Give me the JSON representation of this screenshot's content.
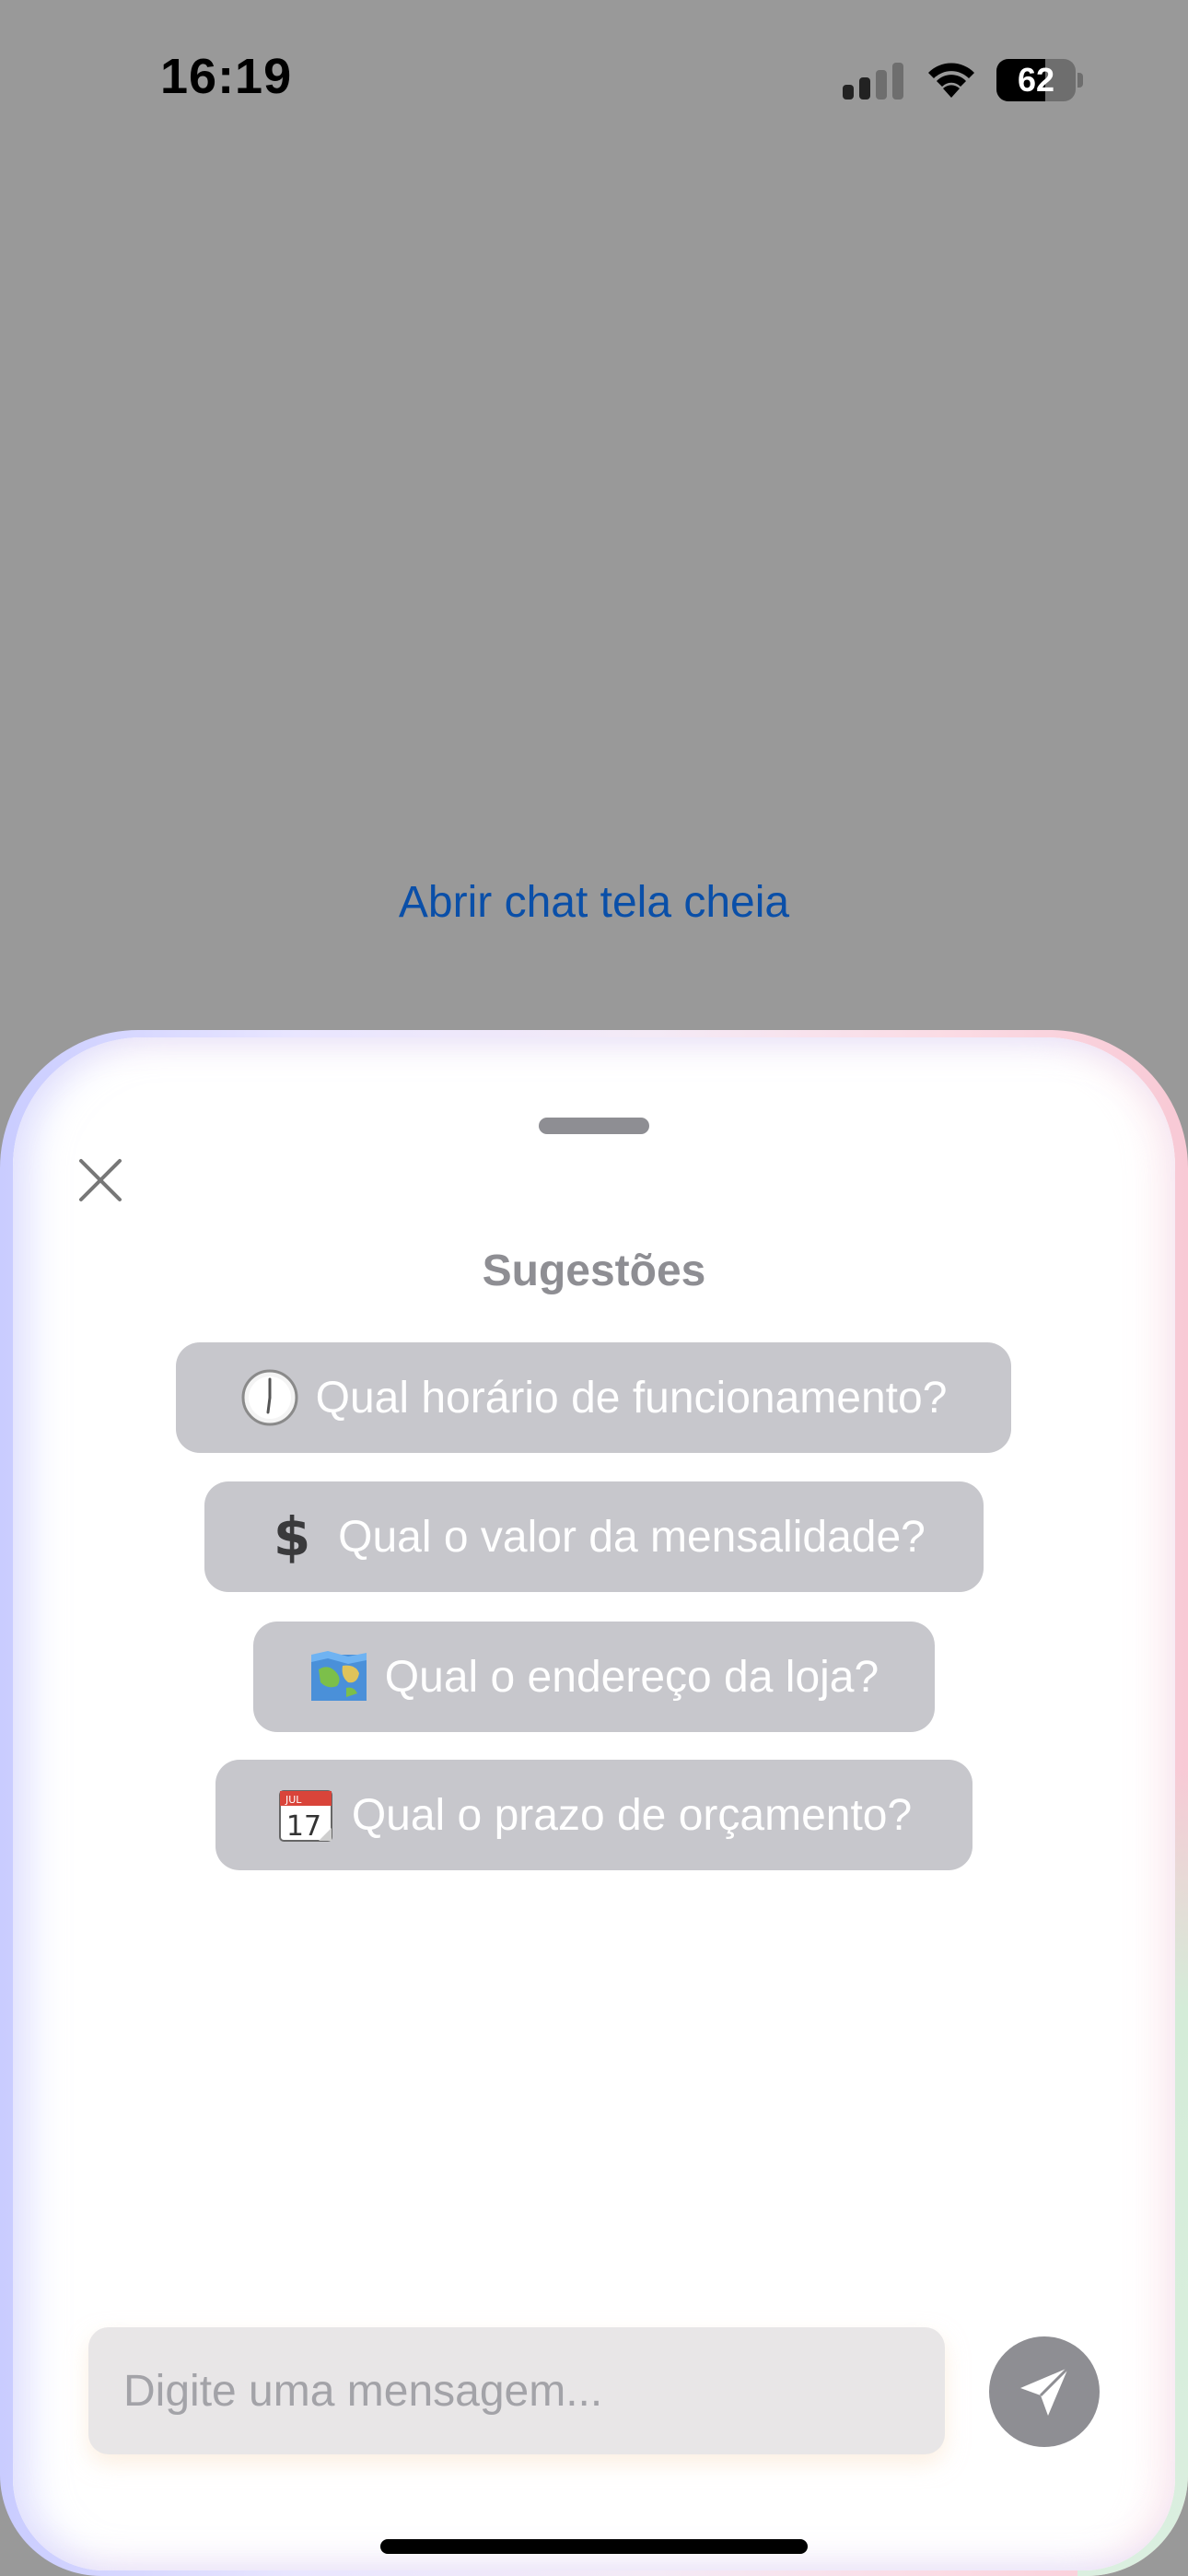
{
  "status_bar": {
    "time": "16:19",
    "battery_level": "62",
    "battery_fraction": 0.62,
    "icons": [
      "cellular-signal-icon",
      "wifi-icon",
      "battery-icon"
    ]
  },
  "background": {
    "open_full_link": "Abrir chat tela cheia",
    "link_color": "#0a4fa8"
  },
  "sheet": {
    "title": "Sugestões",
    "close_icon": "close-icon",
    "suggestions": [
      {
        "icon": "clock-icon",
        "label": "Qual horário de funcionamento?"
      },
      {
        "icon": "dollar-icon",
        "label": "Qual o valor da mensalidade?"
      },
      {
        "icon": "map-icon",
        "label": "Qual o endereço da loja?"
      },
      {
        "icon": "calendar-icon",
        "label": "Qual o prazo de orçamento?",
        "calendar_month": "JUL",
        "calendar_day": "17"
      }
    ]
  },
  "composer": {
    "placeholder": "Digite uma mensagem...",
    "value": "",
    "send_icon": "send-icon"
  }
}
